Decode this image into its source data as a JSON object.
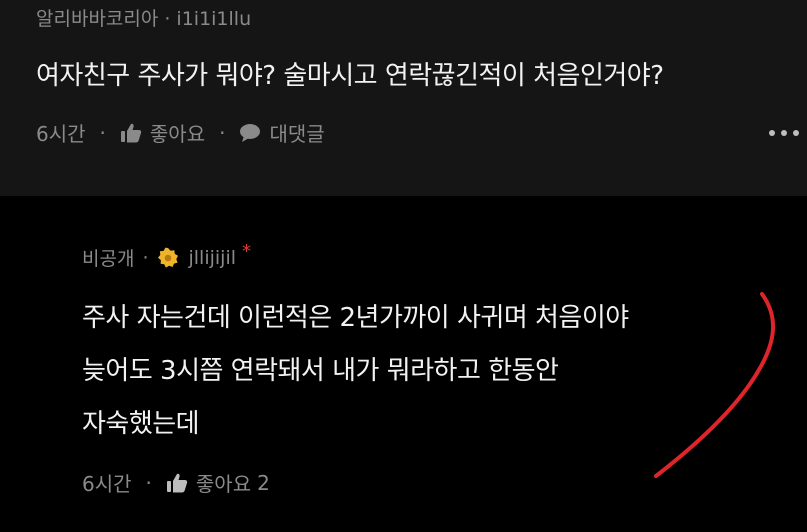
{
  "post": {
    "author_group": "알리바바코리아",
    "nickname": "i1i1i1llu",
    "title": "여자친구 주사가 뭐야? 술마시고 연락끊긴적이 처음인거야?",
    "time": "6시간",
    "like_label": "좋아요",
    "comment_label": "대댓글"
  },
  "reply": {
    "author_group": "비공개",
    "nickname": "jllijijil",
    "badge": "*",
    "lines": [
      "주사 자는건데 이런적은 2년가까이 사귀며 처음이야",
      "늦어도 3시쯤 연락돼서 내가 뭐라하고 한동안",
      "자숙했는데"
    ],
    "time": "6시간",
    "like_label": "좋아요",
    "like_count": "2"
  },
  "icons": {
    "thumbs_up": "thumbs-up-icon",
    "comment": "comment-bubble-icon",
    "more": "more-dots-icon",
    "avatar": "avatar-badge-icon"
  },
  "colors": {
    "background": "#000000",
    "post_background": "#151515",
    "muted_text": "#8a8a8a",
    "annotation": "#e0242c",
    "avatar": "#f0b429"
  }
}
